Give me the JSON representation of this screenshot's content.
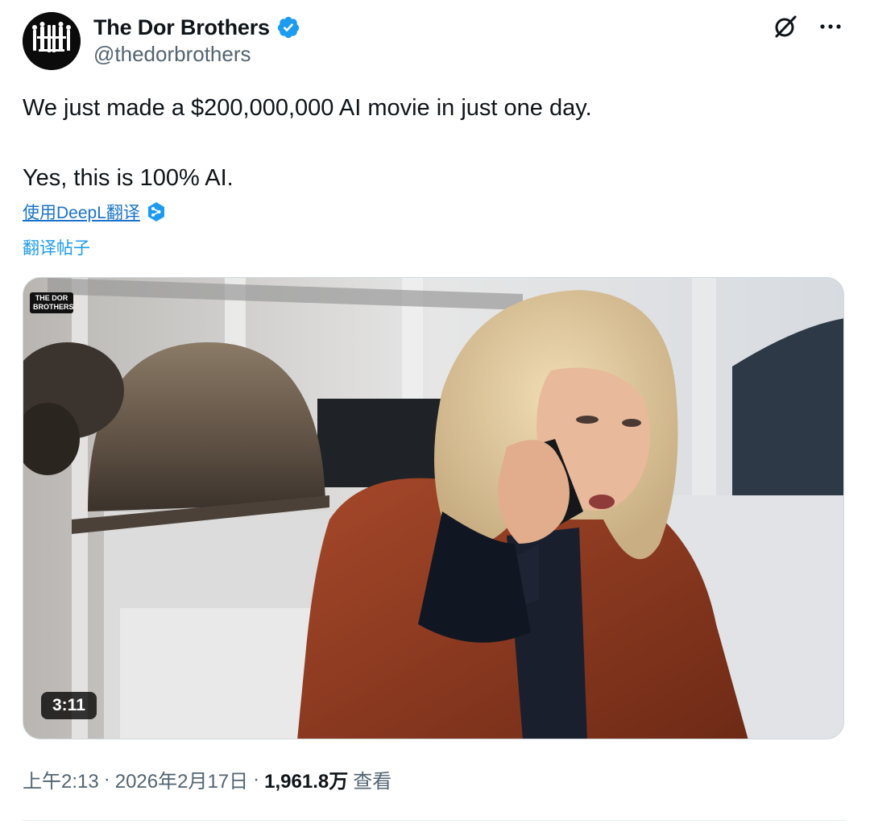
{
  "author": {
    "display_name": "The Dor Brothers",
    "handle": "@thedorbrothers",
    "avatar_icon": "dor-brothers-logo-icon",
    "verified_icon": "verified-badge-icon",
    "verified_color": "#1d9bf0"
  },
  "header_actions": {
    "grok_icon": "grok-icon",
    "more_icon": "more-options-icon"
  },
  "post": {
    "line1": "We just made a $200,000,000 AI movie in just one day.",
    "line2": "Yes, this is 100% AI."
  },
  "translate": {
    "deepl_label": "使用DeepL翻译",
    "deepl_icon": "deepl-icon",
    "post_label": "翻译帖子"
  },
  "media": {
    "watermark_line1": "THE DOR",
    "watermark_line2": "BROTHERS",
    "duration": "3:11"
  },
  "meta": {
    "time": "上午2:13",
    "separator": "·",
    "date": "2026年2月17日",
    "views": "1,961.8万",
    "views_label": "查看"
  },
  "colors": {
    "accent": "#1d9bf0",
    "secondary_text": "#536471",
    "primary_text": "#0f1419"
  }
}
